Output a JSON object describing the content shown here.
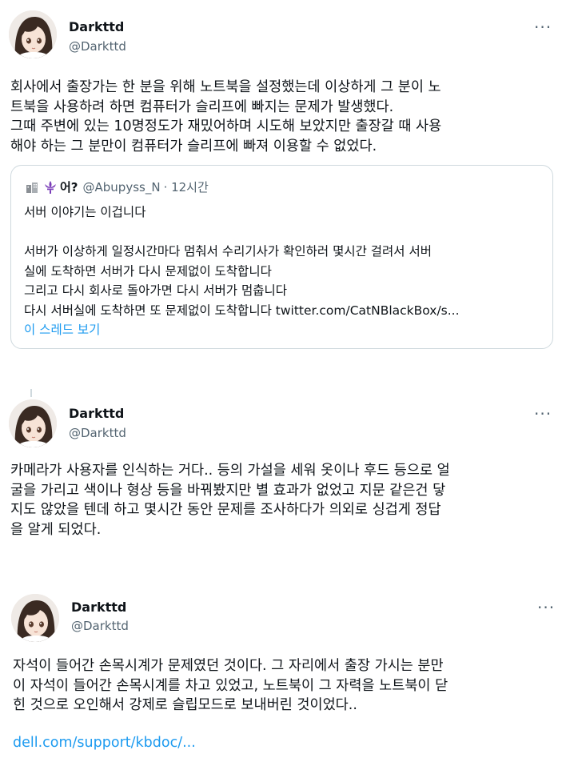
{
  "tweets": [
    {
      "name": "Darkttd",
      "handle": "@Darkttd",
      "more": "···",
      "text": "회사에서 출장가는 한 분을 위해 노트북을 설정했는데 이상하게 그 분이 노\n트북을 사용하려 하면 컴퓨터가 슬리프에 빠지는 문제가 발생했다.\n그때 주변에 있는 10명정도가 재밌어하며 시도해 보았지만 출장갈 때 사용\n해야 하는 그 분만이 컴퓨터가 슬리프에 빠져 이용할 수 없었다.",
      "quote": {
        "icon_building": "building-icon",
        "icon_fleur": "fleur-de-lis-icon",
        "name": "어?",
        "handle": "@Abupyss_N",
        "time": "· 12시간",
        "text": "서버 이야기는 이겁니다\n\n서버가 이상하게 일정시간마다 멈춰서 수리기사가 확인하러 몇시간 걸려서 서버\n실에 도착하면 서버가 다시 문제없이 도착합니다\n그리고 다시 회사로 돌아가면 다시 서버가 멈춥니다\n다시 서버실에 도착하면 또 문제없이 도착합니다 ",
        "link": "twitter.com/CatNBlackBox/s...",
        "show_thread": "이 스레드 보기"
      }
    },
    {
      "name": "Darkttd",
      "handle": "@Darkttd",
      "more": "···",
      "text": "카메라가 사용자를 인식하는 거다.. 등의 가설을 세워 옷이나 후드 등으로 얼\n굴을 가리고 색이나 형상 등을 바꿔봤지만 별 효과가 없었고 지문 같은건 닿\n지도 않았을 텐데 하고 몇시간 동안 문제를 조사하다가 의외로 싱겁게 정답\n을 알게 되었다."
    },
    {
      "name": "Darkttd",
      "handle": "@Darkttd",
      "more": "···",
      "text": "자석이 들어간 손목시계가 문제였던 것이다. 그 자리에서 출장 가시는 분만\n이 자석이 들어간 손목시계를 차고 있었고, 노트북이 그 자력을 노트북이 닫\n힌 것으로 오인해서 강제로 슬립모드로 보내버린 것이었다..",
      "link": "dell.com/support/kbdoc/..."
    }
  ],
  "colors": {
    "text": "#0f1419",
    "secondary": "#536471",
    "link": "#1d9bf0",
    "border": "#cfd9de"
  }
}
